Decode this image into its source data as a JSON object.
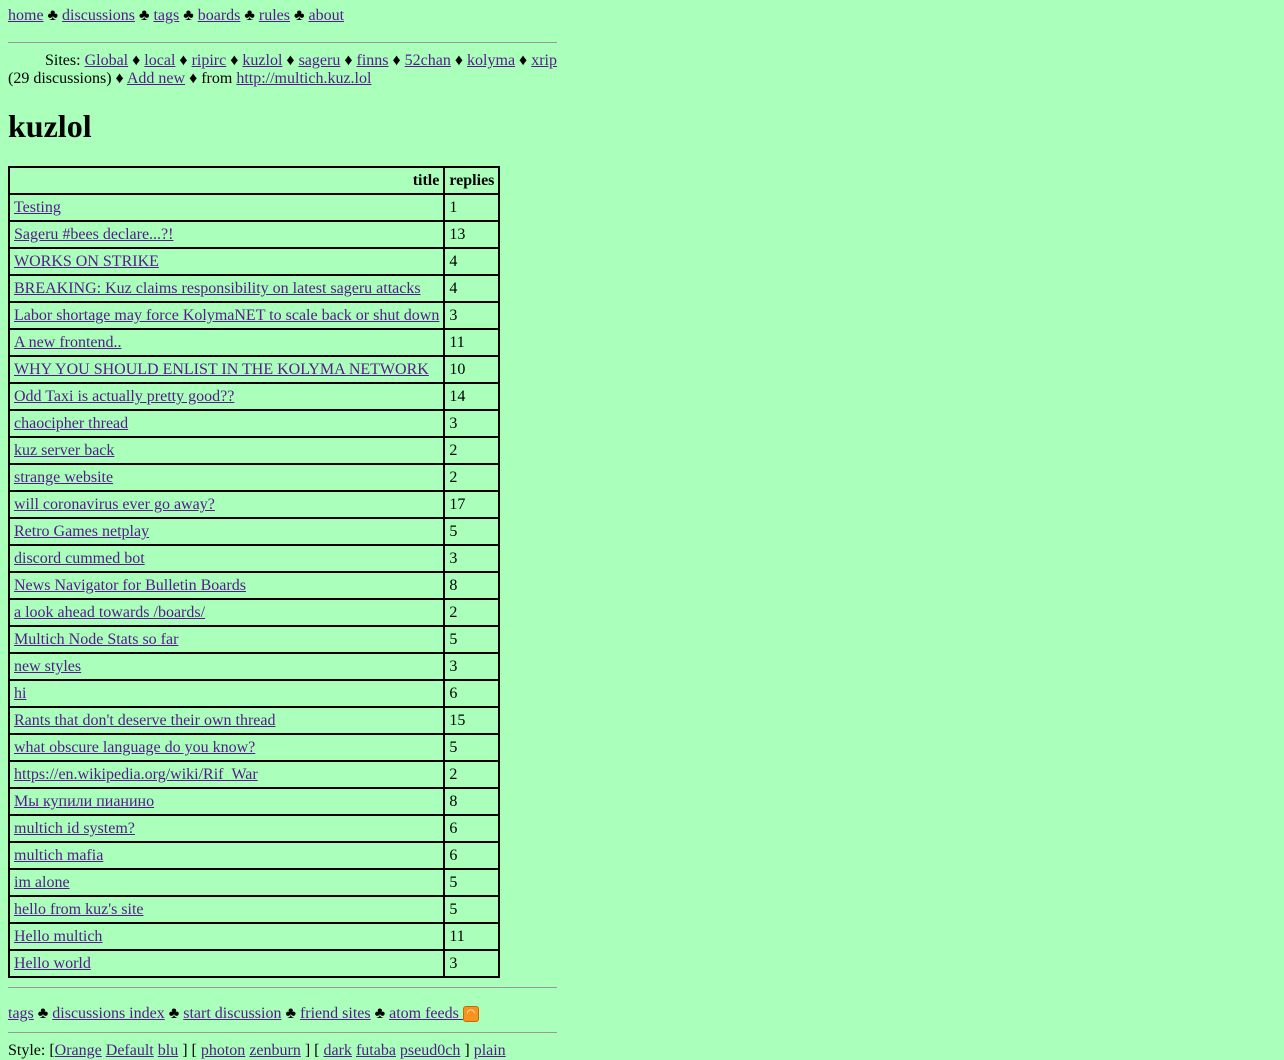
{
  "nav": {
    "items": [
      "home",
      "discussions",
      "tags",
      "boards",
      "rules",
      "about"
    ],
    "separator": "♣"
  },
  "sites": {
    "label": "Sites:",
    "items": [
      "Global",
      "local",
      "ripirc",
      "kuzlol",
      "sageru",
      "finns",
      "52chan",
      "kolyma",
      "xrip"
    ],
    "separator": "♦",
    "count_text": "(29 discussions) ♦",
    "add_new": "Add new",
    "from_text": "♦ from",
    "source_url": "http://multich.kuz.lol"
  },
  "page_title": "kuzlol",
  "table": {
    "headers": {
      "title": "title",
      "replies": "replies"
    },
    "rows": [
      {
        "title": "Testing",
        "replies": "1"
      },
      {
        "title": "Sageru #bees declare...?!",
        "replies": "13"
      },
      {
        "title": "WORKS ON STRIKE",
        "replies": "4"
      },
      {
        "title": "BREAKING: Kuz claims responsibility on latest sageru attacks",
        "replies": "4"
      },
      {
        "title": "Labor shortage may force KolymaNET to scale back or shut down",
        "replies": "3"
      },
      {
        "title": "A new frontend..",
        "replies": "11"
      },
      {
        "title": "WHY YOU SHOULD ENLIST IN THE KOLYMA NETWORK",
        "replies": "10"
      },
      {
        "title": "Odd Taxi is actually pretty good??",
        "replies": "14"
      },
      {
        "title": "chaocipher thread",
        "replies": "3"
      },
      {
        "title": "kuz server back",
        "replies": "2"
      },
      {
        "title": "strange website",
        "replies": "2"
      },
      {
        "title": "will coronavirus ever go away?",
        "replies": "17"
      },
      {
        "title": "Retro Games netplay",
        "replies": "5"
      },
      {
        "title": "discord cummed bot",
        "replies": "3"
      },
      {
        "title": "News Navigator for Bulletin Boards",
        "replies": "8"
      },
      {
        "title": "a look ahead towards /boards/",
        "replies": "2"
      },
      {
        "title": "Multich Node Stats so far",
        "replies": "5"
      },
      {
        "title": "new styles",
        "replies": "3"
      },
      {
        "title": "hi",
        "replies": "6"
      },
      {
        "title": "Rants that don't deserve their own thread",
        "replies": "15"
      },
      {
        "title": "what obscure language do you know?",
        "replies": "5"
      },
      {
        "title": "https://en.wikipedia.org/wiki/Rif_War",
        "replies": "2"
      },
      {
        "title": "Мы купили пианино",
        "replies": "8"
      },
      {
        "title": "multich id system?",
        "replies": "6"
      },
      {
        "title": "multich mafia",
        "replies": "6"
      },
      {
        "title": "im alone",
        "replies": "5"
      },
      {
        "title": "hello from kuz's site",
        "replies": "5"
      },
      {
        "title": "Hello multich",
        "replies": "11"
      },
      {
        "title": "Hello world",
        "replies": "3"
      }
    ]
  },
  "footer": {
    "links": [
      "tags",
      "discussions index",
      "start discussion",
      "friend sites",
      "atom feeds"
    ],
    "separator": "♣",
    "rss_icon": "rss-icon"
  },
  "style_bar": {
    "label": "Style: [",
    "group1": [
      "Orange",
      "Default",
      "blu"
    ],
    "group2": [
      "photon",
      "zenburn"
    ],
    "group3": [
      "dark",
      "futaba",
      "pseud0ch"
    ],
    "plain": "plain"
  },
  "colors": {
    "background": "#aaffbb",
    "link": "#551a8b"
  }
}
